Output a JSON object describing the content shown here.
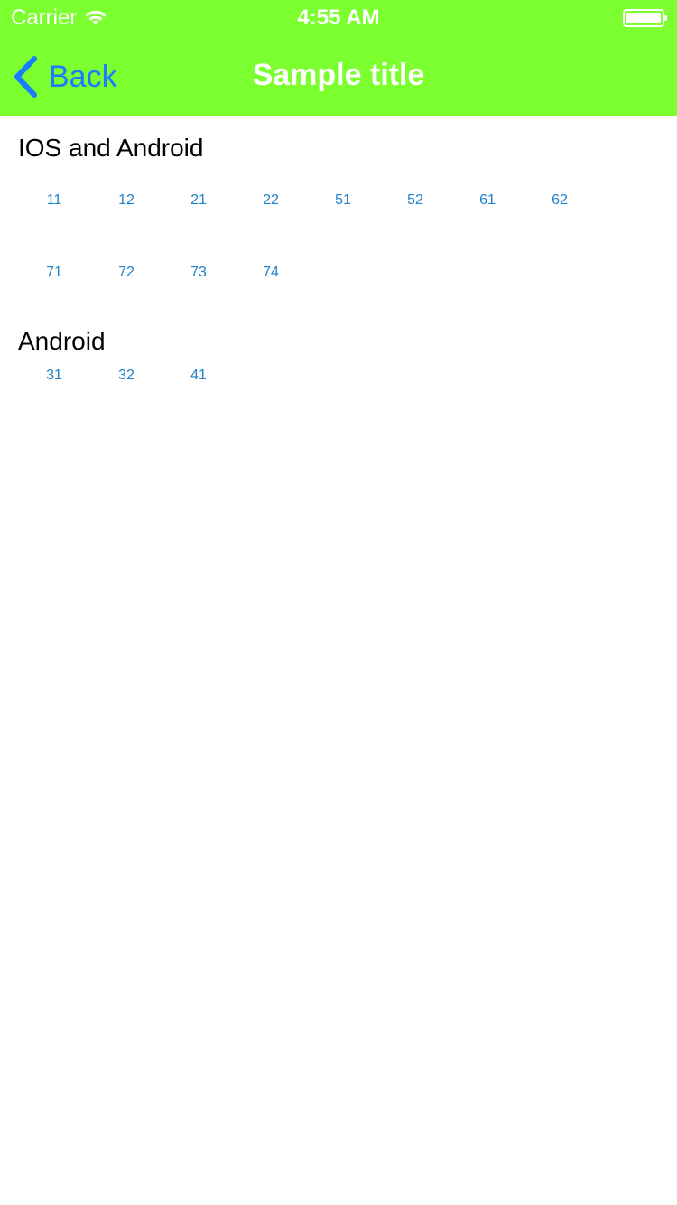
{
  "colors": {
    "header_background": "#7bff2e",
    "header_text": "#ffffff",
    "back_tint": "#1a7cff",
    "grid_text": "#1f82c8",
    "section_text": "#000000"
  },
  "status_bar": {
    "carrier": "Carrier",
    "time": "4:55 AM",
    "wifi_icon": "wifi-icon",
    "battery_icon": "battery-icon"
  },
  "navbar": {
    "back_label": "Back",
    "back_icon": "chevron-left-icon",
    "title": "Sample title"
  },
  "sections": [
    {
      "title": "IOS and Android",
      "items": [
        "11",
        "12",
        "21",
        "22",
        "51",
        "52",
        "61",
        "62",
        "71",
        "72",
        "73",
        "74"
      ]
    },
    {
      "title": "Android",
      "items": [
        "31",
        "32",
        "41"
      ]
    }
  ]
}
